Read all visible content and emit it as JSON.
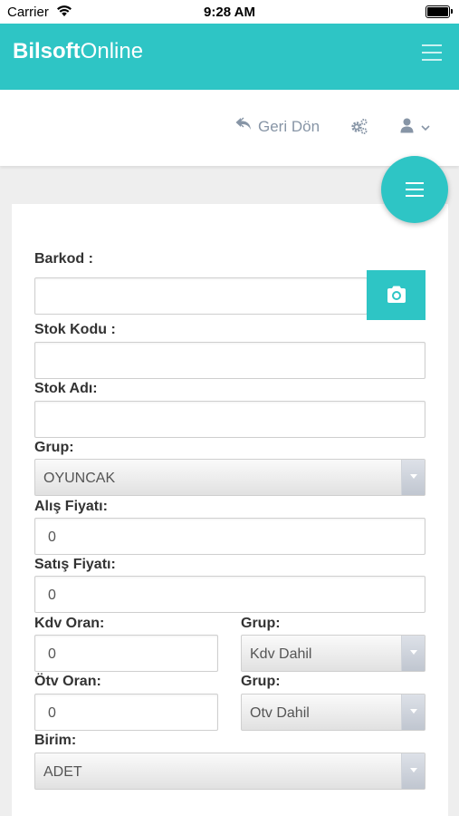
{
  "status_bar": {
    "carrier": "Carrier",
    "time": "9:28 AM"
  },
  "app": {
    "brand_bold": "Bilsoft",
    "brand_light": "Online"
  },
  "toolbar": {
    "back_label": "Geri Dön"
  },
  "form": {
    "barkod": {
      "label": "Barkod :",
      "value": ""
    },
    "stok_kodu": {
      "label": "Stok Kodu :",
      "value": ""
    },
    "stok_adi": {
      "label": "Stok Adı:",
      "value": ""
    },
    "grup": {
      "label": "Grup:",
      "value": "OYUNCAK"
    },
    "alis_fiyati": {
      "label": "Alış Fiyatı:",
      "value": "0"
    },
    "satis_fiyati": {
      "label": "Satış Fiyatı:",
      "value": "0"
    },
    "kdv_oran": {
      "label": "Kdv Oran:",
      "value": "0"
    },
    "kdv_grup": {
      "label": "Grup:",
      "value": "Kdv Dahil"
    },
    "otv_oran": {
      "label": "Ötv Oran:",
      "value": "0"
    },
    "otv_grup": {
      "label": "Grup:",
      "value": "Otv Dahil"
    },
    "birim": {
      "label": "Birim:",
      "value": "ADET"
    }
  },
  "colors": {
    "accent": "#2ec5c5",
    "toolbar_icon": "#8795a6"
  },
  "icons": {
    "wifi": "wifi-icon",
    "battery": "battery-icon",
    "menu": "hamburger-menu-icon",
    "back": "reply-icon",
    "settings": "gears-icon",
    "user": "user-icon",
    "dropdown": "chevron-down-icon",
    "camera": "camera-icon"
  }
}
